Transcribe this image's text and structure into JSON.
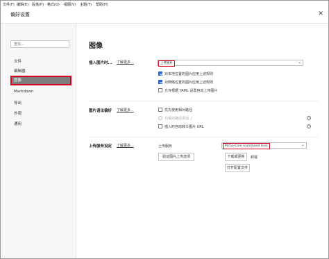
{
  "menu": [
    "文件(F)",
    "编辑(E)",
    "段落(P)",
    "格式(O)",
    "视图(V)",
    "主题(T)",
    "帮助(H)"
  ],
  "window_title": "偏好设置",
  "close_glyph": "✕",
  "search_placeholder": "查找...",
  "sidebar": [
    "文件",
    "编辑器",
    "图像",
    "Markdown",
    "导出",
    "外观",
    "通用"
  ],
  "main": {
    "heading": "图像",
    "insert": {
      "label": "插入图片时...",
      "learn_more": "了解更多...",
      "select_value": "上传图片",
      "options": [
        "对本地位置的图片应用上述规则",
        "对网络位置的图片应用上述规则",
        "允许根据 YAML 设置自动上传图片"
      ],
      "checked": [
        true,
        true,
        false
      ]
    },
    "syntax": {
      "label": "图片语法偏好",
      "learn_more": "了解更多...",
      "options": [
        "优先使用相对路径",
        "为相对路径添加 ./",
        "插入时自动转义图片 URL"
      ],
      "help_glyph": "?"
    },
    "upload": {
      "label": "上传服务设定",
      "learn_more": "了解更多...",
      "service_label": "上传服务",
      "service_value": "PicGo-Core (command line)",
      "verify_button": "验证图片上传选项",
      "download_button": "下载或更新",
      "uninstall_link": "卸载",
      "open_config_button": "打开配置文件"
    }
  }
}
